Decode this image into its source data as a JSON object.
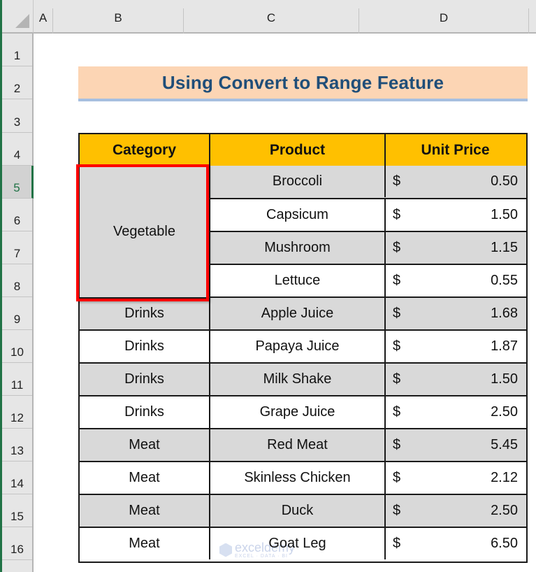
{
  "spreadsheet": {
    "column_headers": [
      "A",
      "B",
      "C",
      "D"
    ],
    "row_headers": [
      "1",
      "2",
      "3",
      "4",
      "5",
      "6",
      "7",
      "8",
      "9",
      "10",
      "11",
      "12",
      "13",
      "14",
      "15",
      "16"
    ],
    "active_row": "5",
    "title": "Using Convert to Range Feature",
    "table": {
      "headers": [
        "Category",
        "Product",
        "Unit Price"
      ],
      "merged_category": "Vegetable",
      "rows": [
        {
          "category": "",
          "product": "Broccoli",
          "currency": "$",
          "price": "0.50"
        },
        {
          "category": "",
          "product": "Capsicum",
          "currency": "$",
          "price": "1.50"
        },
        {
          "category": "",
          "product": "Mushroom",
          "currency": "$",
          "price": "1.15"
        },
        {
          "category": "",
          "product": "Lettuce",
          "currency": "$",
          "price": "0.55"
        },
        {
          "category": "Drinks",
          "product": "Apple Juice",
          "currency": "$",
          "price": "1.68"
        },
        {
          "category": "Drinks",
          "product": "Papaya Juice",
          "currency": "$",
          "price": "1.87"
        },
        {
          "category": "Drinks",
          "product": "Milk Shake",
          "currency": "$",
          "price": "1.50"
        },
        {
          "category": "Drinks",
          "product": "Grape Juice",
          "currency": "$",
          "price": "2.50"
        },
        {
          "category": "Meat",
          "product": "Red Meat",
          "currency": "$",
          "price": "5.45"
        },
        {
          "category": "Meat",
          "product": "Skinless Chicken",
          "currency": "$",
          "price": "2.12"
        },
        {
          "category": "Meat",
          "product": "Duck",
          "currency": "$",
          "price": "2.50"
        },
        {
          "category": "Meat",
          "product": "Goat Leg",
          "currency": "$",
          "price": "6.50"
        }
      ]
    },
    "watermark": {
      "name": "exceldemy",
      "tagline": "EXCEL · DATA · BI"
    },
    "colors": {
      "header_fill": "#ffc000",
      "title_fill": "#fcd5b4",
      "title_text": "#1f4e79",
      "shaded_row": "#d9d9d9",
      "selection_outline": "#ff0000",
      "excel_green": "#217346"
    }
  }
}
